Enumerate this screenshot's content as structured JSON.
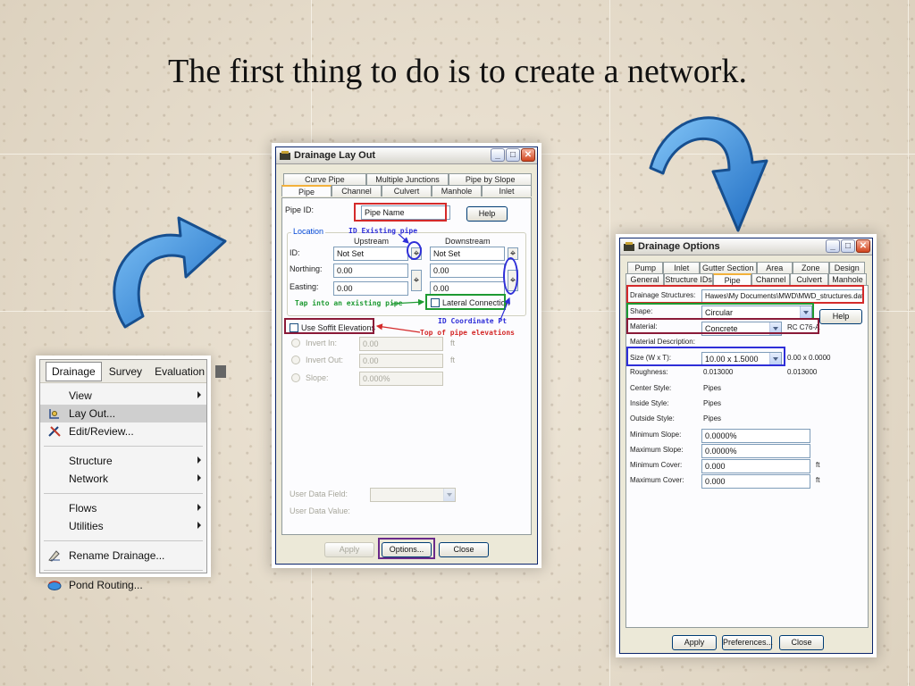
{
  "slide": {
    "title": "The first thing to do is to create a network."
  },
  "colors": {
    "arrow_blue": "#2f8fe0",
    "annotation_red": "#d42a2a",
    "annotation_blue": "#2f2fd8",
    "annotation_green": "#1e9a32",
    "annotation_maroon": "#8a1a38",
    "annotation_purple": "#6a2a8a"
  },
  "menu": {
    "bar": [
      "Drainage",
      "Survey",
      "Evaluation"
    ],
    "items": [
      {
        "label": "View",
        "submenu": true,
        "icon": ""
      },
      {
        "label": "Lay Out...",
        "submenu": false,
        "icon": "layout-tool-icon",
        "highlighted": true
      },
      {
        "label": "Edit/Review...",
        "submenu": false,
        "icon": "edit-review-icon"
      },
      {
        "label": "Structure",
        "submenu": true,
        "icon": ""
      },
      {
        "label": "Network",
        "submenu": true,
        "icon": ""
      },
      {
        "label": "Flows",
        "submenu": true,
        "icon": ""
      },
      {
        "label": "Utilities",
        "submenu": true,
        "icon": ""
      },
      {
        "label": "Rename Drainage...",
        "submenu": false,
        "icon": "rename-icon"
      },
      {
        "label": "Pond Routing...",
        "submenu": false,
        "icon": "pond-icon"
      }
    ]
  },
  "layout_dialog": {
    "title": "Drainage Lay Out",
    "tabs_row1": [
      "Curve Pipe",
      "Multiple Junctions",
      "Pipe by Slope"
    ],
    "tabs_row2": [
      "Pipe",
      "Channel",
      "Culvert",
      "Manhole",
      "Inlet"
    ],
    "pipe_id_label": "Pipe ID:",
    "pipe_id_value": "Pipe Name",
    "help": "Help",
    "location_label": "Location",
    "upstream": "Upstream",
    "downstream": "Downstream",
    "id_label": "ID:",
    "northing_label": "Northing:",
    "easting_label": "Easting:",
    "up_id": "Not Set",
    "down_id": "Not Set",
    "up_northing": "0.00",
    "down_northing": "0.00",
    "up_easting": "0.00",
    "down_easting": "0.00",
    "lateral_connection": "Lateral Connection",
    "use_soffit": "Use Soffit Elevations",
    "invert_in": "Invert In:",
    "invert_out": "Invert Out:",
    "slope": "Slope:",
    "invert_in_value": "0.00",
    "invert_out_value": "0.00",
    "slope_value": "0.000%",
    "unit_ft": "ft",
    "user_data_field": "User Data Field:",
    "user_data_value": "User Data Value:",
    "apply": "Apply",
    "options": "Options...",
    "close": "Close",
    "annotations": {
      "id_existing": "ID Existing pipe",
      "tap_existing": "Tap into an existing pipe",
      "id_coordinate": "ID Coordinate Pt",
      "top_of_pipe": "Top of pipe elevations"
    }
  },
  "options_dialog": {
    "title": "Drainage Options",
    "tabs_row1": [
      "Pump",
      "Inlet",
      "Gutter Section",
      "Area",
      "Zone",
      "Design"
    ],
    "tabs_row2": [
      "General",
      "Structure IDs",
      "Pipe",
      "Channel",
      "Culvert",
      "Manhole"
    ],
    "drainage_structures_label": "Drainage Structures:",
    "drainage_structures_value": "Hawes\\My Documents\\MWD\\MWD_structures.dat",
    "shape_label": "Shape:",
    "shape_value": "Circular",
    "help": "Help",
    "material_label": "Material:",
    "material_value": "Concrete",
    "material_code": "RC C76-A",
    "material_desc_label": "Material Description:",
    "size_label": "Size (W x T):",
    "size_value": "10.00 x 1.5000",
    "size_extra": "0.00 x 0.0000",
    "roughness_label": "Roughness:",
    "roughness_value": "0.013000",
    "roughness_value2": "0.013000",
    "center_style_label": "Center Style:",
    "center_style_value": "Pipes",
    "inside_style_label": "Inside Style:",
    "inside_style_value": "Pipes",
    "outside_style_label": "Outside Style:",
    "outside_style_value": "Pipes",
    "min_slope_label": "Minimum Slope:",
    "min_slope_value": "0.0000%",
    "max_slope_label": "Maximum Slope:",
    "max_slope_value": "0.0000%",
    "min_cover_label": "Minimum Cover:",
    "min_cover_value": "0.000",
    "max_cover_label": "Maximum Cover:",
    "max_cover_value": "0.000",
    "unit_ft": "ft",
    "apply": "Apply",
    "preferences": "Preferences...",
    "close": "Close"
  }
}
